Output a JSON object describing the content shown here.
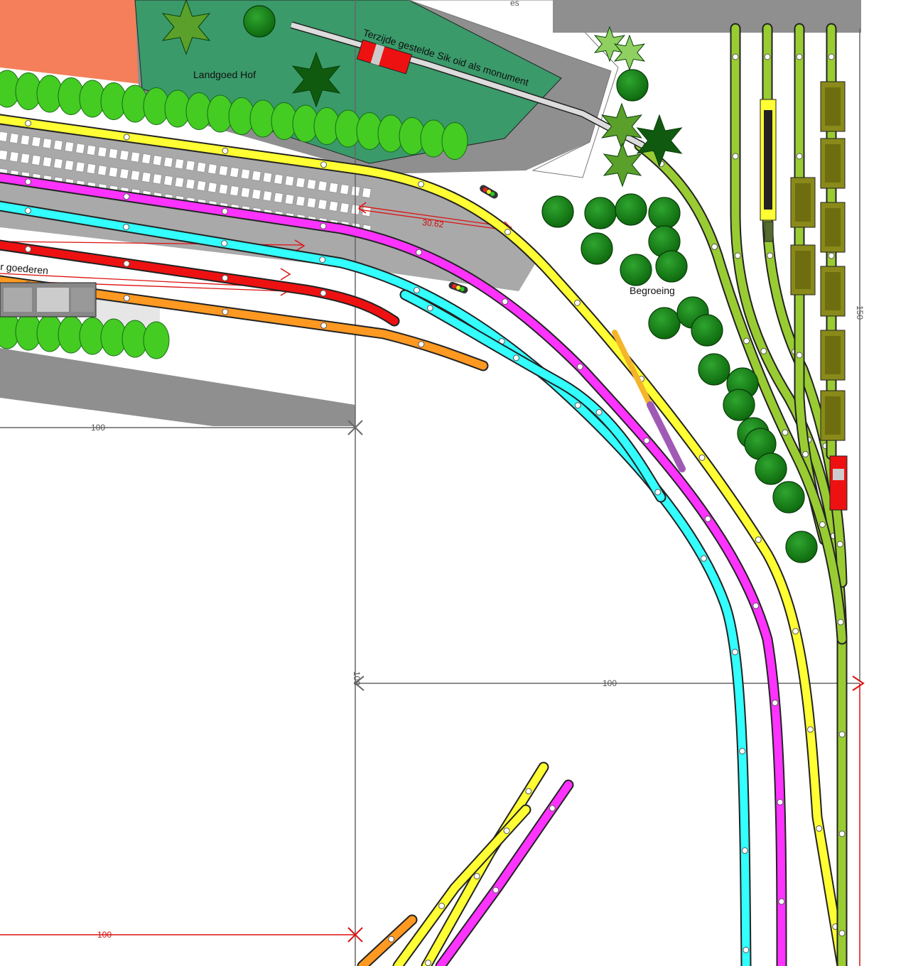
{
  "labels": {
    "park": "Landgoed Hof",
    "monument": "Terzijde gestelde Sik oid als monument",
    "vegetation": "Begroeing",
    "goods": "r goederen",
    "top_cut": "es"
  },
  "dimensions": {
    "left_100": "100",
    "middle_100": "100",
    "bottom_100": "100",
    "right_150": "150",
    "vertical_100": "100",
    "platform_length": "30.62"
  },
  "colors": {
    "background": "#ffffff",
    "grass": "#3a9a6a",
    "grey_area": "#8f8f8f",
    "orange_building": "#f47f5a",
    "track_yellow": "#ffff33",
    "track_magenta": "#ff33ff",
    "track_cyan": "#33ffff",
    "track_red": "#ee1111",
    "track_orange": "#ff9922",
    "track_green": "#99cc33",
    "tree_green": "#1d8a1d",
    "hedge_green": "#44cc22",
    "dimension_red": "#dd1111",
    "dimension_grey": "#666666"
  },
  "icons": [
    "tree-icon",
    "signal-icon",
    "dimension-arrow-icon",
    "train-wagon-icon"
  ]
}
